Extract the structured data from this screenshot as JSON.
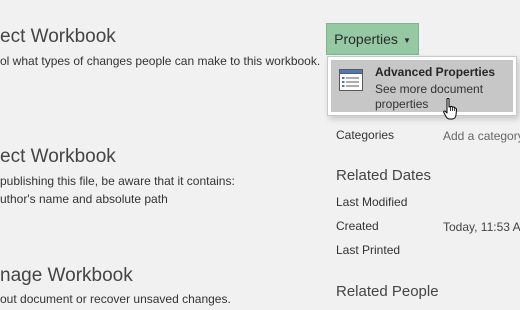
{
  "left": {
    "sections": [
      {
        "title": "ect Workbook",
        "desc": "ol what types of changes people can make to this workbook."
      },
      {
        "title": "ect Workbook",
        "desc": "publishing this file, be aware that it contains:",
        "desc2": "uthor's name and absolute path"
      },
      {
        "title": "nage Workbook",
        "desc": "out document or recover unsaved changes."
      }
    ]
  },
  "properties_button": {
    "label": "Properties",
    "chevron_icon": "chevron-down-icon"
  },
  "dropdown": {
    "item": {
      "icon": "document-properties-icon",
      "title": "Advanced Properties",
      "desc": "See more document properties"
    }
  },
  "right": {
    "categories": {
      "label": "Categories",
      "value": "Add a category"
    },
    "related_dates": {
      "title": "Related Dates",
      "last_modified": "Last Modified",
      "created": {
        "label": "Created",
        "value": "Today, 11:53 A"
      },
      "last_printed": "Last Printed"
    },
    "related_people": {
      "title": "Related People"
    }
  },
  "colors": {
    "background": "#f1f1f1",
    "accent_button": "#95c9a4",
    "menu_highlight": "#c7c7c7"
  }
}
